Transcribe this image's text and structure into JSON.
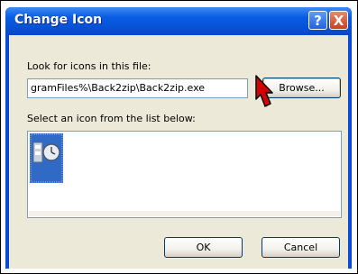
{
  "dialog": {
    "title": "Change Icon",
    "help_button": "?",
    "close_button": "X",
    "look_label": "Look for icons in this file:",
    "file_path": "gramFiles%\\Back2zip\\Back2zip.exe",
    "browse_label": "Browse...",
    "select_label": "Select an icon from the list below:",
    "ok_label": "OK",
    "cancel_label": "Cancel"
  },
  "icons": [
    {
      "name": "app-clock-icon",
      "selected": true
    }
  ],
  "colors": {
    "titlebar": "#0653d6",
    "selection": "#316ac5",
    "cursor": "#d40000"
  }
}
